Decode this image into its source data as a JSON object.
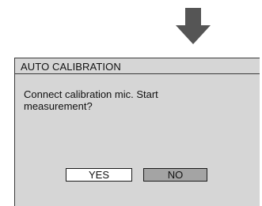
{
  "arrow": {
    "icon": "down-arrow-icon",
    "color": "#555555"
  },
  "dialog": {
    "title": "AUTO CALIBRATION",
    "message_line1": "Connect calibration mic. Start",
    "message_line2": "measurement?",
    "background": "#d6d6d6",
    "buttons": {
      "yes_label": "YES",
      "no_label": "NO",
      "yes_color": "#ffffff",
      "no_color": "#a4a4a4"
    }
  }
}
